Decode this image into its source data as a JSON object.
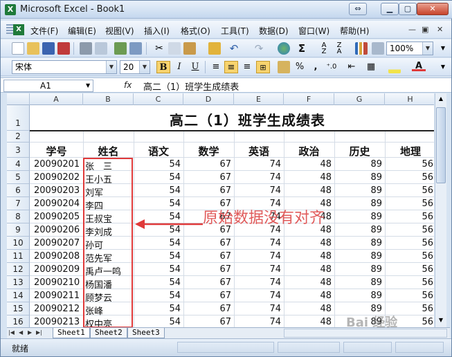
{
  "window": {
    "title": "Microsoft Excel - Book1",
    "icon": "excel-app-icon"
  },
  "menus": [
    "文件(F)",
    "编辑(E)",
    "视图(V)",
    "插入(I)",
    "格式(O)",
    "工具(T)",
    "数据(D)",
    "窗口(W)",
    "帮助(H)"
  ],
  "toolbar": {
    "zoom": "100%",
    "sum_symbol": "Σ",
    "font_name": "宋体",
    "font_size": "20",
    "bold": "B",
    "italic": "I",
    "underline": "U",
    "percent": "%",
    "comma": ",",
    "font_color_letter": "A"
  },
  "formula_bar": {
    "cell_ref": "A1",
    "fx": "fx",
    "content": "高二（1）班学生成绩表"
  },
  "columns": [
    "A",
    "B",
    "C",
    "D",
    "E",
    "F",
    "G",
    "H"
  ],
  "rows": [
    "1",
    "2",
    "3",
    "4",
    "5",
    "6",
    "7",
    "8",
    "9",
    "10",
    "11",
    "12",
    "13",
    "14",
    "15",
    "16"
  ],
  "sheet": {
    "title": "高二（1）班学生成绩表",
    "headers": [
      "学号",
      "姓名",
      "语文",
      "数学",
      "英语",
      "政治",
      "历史",
      "地理"
    ],
    "records": [
      [
        "20090201",
        "张　三",
        "54",
        "67",
        "74",
        "48",
        "89",
        "56"
      ],
      [
        "20090202",
        "王小五",
        "54",
        "67",
        "74",
        "48",
        "89",
        "56"
      ],
      [
        "20090203",
        "刘军",
        "54",
        "67",
        "74",
        "48",
        "89",
        "56"
      ],
      [
        "20090204",
        "李四",
        "54",
        "67",
        "74",
        "48",
        "89",
        "56"
      ],
      [
        "20090205",
        "王叔宝",
        "54",
        "67",
        "74",
        "48",
        "89",
        "56"
      ],
      [
        "20090206",
        "李刘成",
        "54",
        "67",
        "74",
        "48",
        "89",
        "56"
      ],
      [
        "20090207",
        "孙可",
        "54",
        "67",
        "74",
        "48",
        "89",
        "56"
      ],
      [
        "20090208",
        "范先军",
        "54",
        "67",
        "74",
        "48",
        "89",
        "56"
      ],
      [
        "20090209",
        "禹卢一鸣",
        "54",
        "67",
        "74",
        "48",
        "89",
        "56"
      ],
      [
        "20090210",
        "杨国潘",
        "54",
        "67",
        "74",
        "48",
        "89",
        "56"
      ],
      [
        "20090211",
        "顾梦云",
        "54",
        "67",
        "74",
        "48",
        "89",
        "56"
      ],
      [
        "20090212",
        "张峰",
        "54",
        "67",
        "74",
        "48",
        "89",
        "56"
      ],
      [
        "20090213",
        "权中亮",
        "54",
        "67",
        "74",
        "48",
        "89",
        "56"
      ]
    ]
  },
  "annotation": {
    "text": "原始数据没有对齐",
    "color": "#e03a3a"
  },
  "sheet_tabs": [
    "Sheet1",
    "Sheet2",
    "Sheet3"
  ],
  "status": "就绪",
  "watermark": "Bai 经验"
}
